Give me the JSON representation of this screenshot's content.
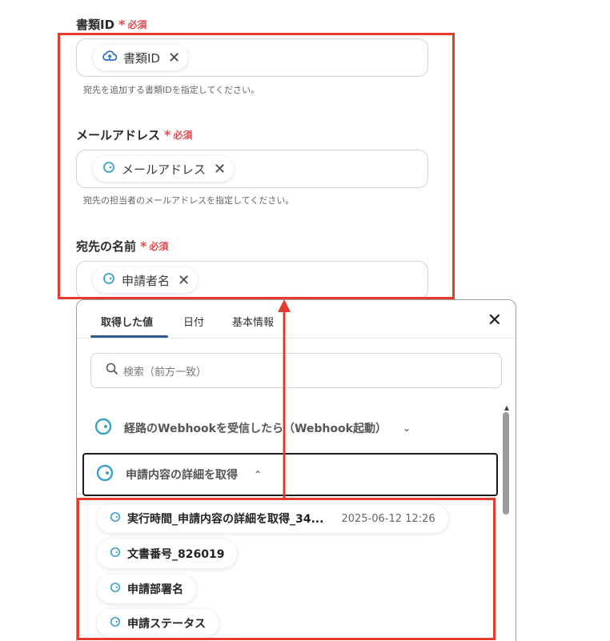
{
  "fields": [
    {
      "label": "書類ID",
      "required": "必須",
      "chip": "書類ID",
      "chip_icon": "cloud-icon",
      "hint": "宛先を追加する書類IDを指定してください。"
    },
    {
      "label": "メールアドレス",
      "required": "必須",
      "chip": "メールアドレス",
      "chip_icon": "webhook-icon",
      "hint": "宛先の担当者のメールアドレスを指定してください。"
    },
    {
      "label": "宛先の名前",
      "required": "必須",
      "chip": "申請者名",
      "chip_icon": "webhook-icon"
    }
  ],
  "panel": {
    "tabs": [
      "取得した値",
      "日付",
      "基本情報"
    ],
    "active_tab": "取得した値",
    "search_placeholder": "検索（前方一致）",
    "groups": [
      {
        "label": "経路のWebhookを受信したら（Webhook起動）",
        "expanded": false
      },
      {
        "label": "申請内容の詳細を取得",
        "expanded": true
      }
    ],
    "items": [
      {
        "label": "実行時間_申請内容の詳細を取得_34...",
        "timestamp": "2025-06-12 12:26"
      },
      {
        "label": "文書番号_826019"
      },
      {
        "label": "申請部署名"
      },
      {
        "label": "申請ステータス"
      }
    ]
  },
  "colors": {
    "required": "#e5484d",
    "highlight": "#e53a2c",
    "accent": "#2f5a8a"
  }
}
